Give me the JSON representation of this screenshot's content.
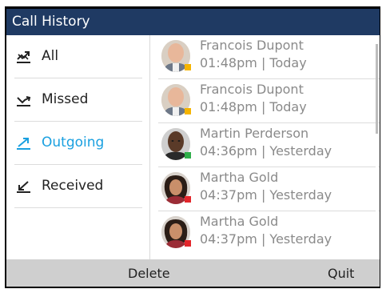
{
  "header": {
    "title": "Call History"
  },
  "filters": [
    {
      "label": "All",
      "icon": "all-calls-icon",
      "selected": false
    },
    {
      "label": "Missed",
      "icon": "missed-call-icon",
      "selected": false
    },
    {
      "label": "Outgoing",
      "icon": "outgoing-call-icon",
      "selected": true
    },
    {
      "label": "Received",
      "icon": "received-call-icon",
      "selected": false
    }
  ],
  "calls": [
    {
      "name": "Francois Dupont",
      "time": "01:48pm | Today",
      "status_color": "#f5b400"
    },
    {
      "name": "Francois Dupont",
      "time": "01:48pm | Today",
      "status_color": "#f5b400"
    },
    {
      "name": "Martin Perderson",
      "time": "04:36pm | Yesterday",
      "status_color": "#2fae4a"
    },
    {
      "name": "Martha Gold",
      "time": "04:37pm | Yesterday",
      "status_color": "#e3262b"
    },
    {
      "name": "Martha Gold",
      "time": "04:37pm | Yesterday",
      "status_color": "#e3262b"
    }
  ],
  "softkeys": {
    "delete_label": "Delete",
    "quit_label": "Quit"
  },
  "colors": {
    "header_bg": "#1f3a63",
    "accent": "#1aa0e0",
    "softkey_bg": "#cfcfcf"
  }
}
